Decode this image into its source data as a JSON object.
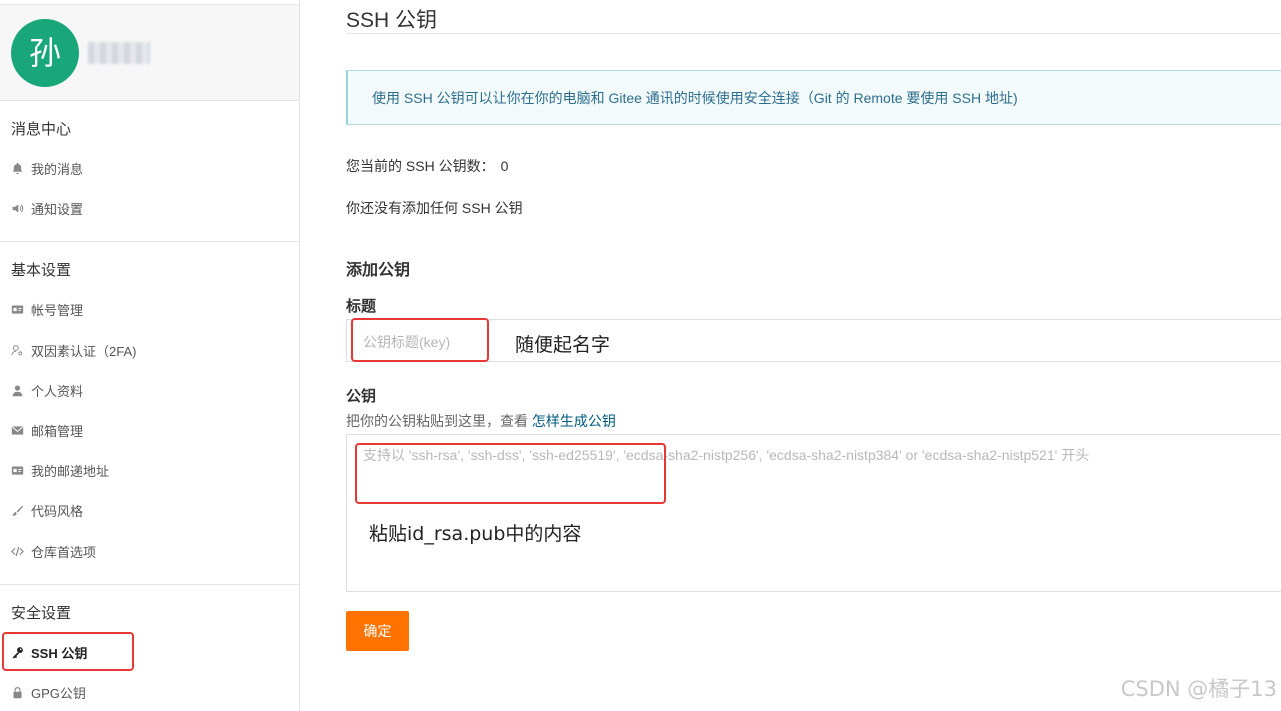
{
  "sidebar": {
    "avatar_char": "孙",
    "sections": {
      "message": {
        "title": "消息中心",
        "items": [
          "我的消息",
          "通知设置"
        ]
      },
      "basic": {
        "title": "基本设置",
        "items": [
          "帐号管理",
          "双因素认证（2FA)",
          "个人资料",
          "邮箱管理",
          "我的邮递地址",
          "代码风格",
          "仓库首选项"
        ]
      },
      "security": {
        "title": "安全设置",
        "items": [
          "SSH 公钥",
          "GPG公钥"
        ]
      }
    }
  },
  "main": {
    "title": "SSH 公钥",
    "info": "使用 SSH 公钥可以让你在你的电脑和 Gitee 通讯的时候使用安全连接（Git 的 Remote 要使用 SSH 地址)",
    "count_label": "您当前的 SSH 公钥数：",
    "count_value": "0",
    "none_text": "你还没有添加任何 SSH 公钥",
    "add_heading": "添加公钥",
    "title_label": "标题",
    "title_placeholder": "公钥标题(key)",
    "title_annotation": "随便起名字",
    "key_label": "公钥",
    "key_hint": "把你的公钥粘贴到这里，查看 ",
    "key_hint_link": "怎样生成公钥",
    "key_placeholder": "支持以 'ssh-rsa', 'ssh-dss', 'ssh-ed25519', 'ecdsa-sha2-nistp256', 'ecdsa-sha2-nistp384' or 'ecdsa-sha2-nistp521' 开头",
    "key_annotation": "粘贴id_rsa.pub中的内容",
    "submit_label": "确定"
  },
  "watermark": "CSDN @橘子13",
  "colors": {
    "avatar": "#19a779",
    "accent_button": "#fe7300",
    "info_text": "#2e6e8e",
    "highlight_box": "#e53935"
  }
}
